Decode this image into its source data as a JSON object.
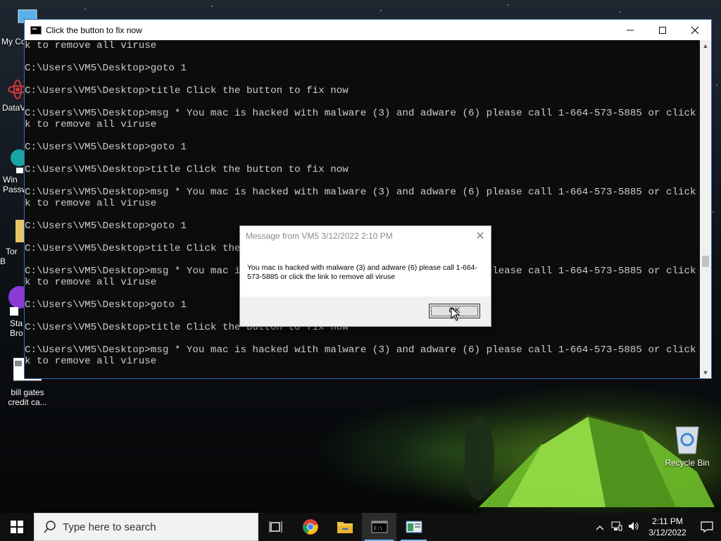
{
  "desktop": {
    "icons": [
      {
        "label": "My Co"
      },
      {
        "label": "DataV"
      },
      {
        "label": "Win Passw"
      },
      {
        "label": "Tor B"
      },
      {
        "label": "Sta Bro"
      },
      {
        "label": "bill gates credit ca..."
      },
      {
        "label": "Recycle Bin"
      }
    ]
  },
  "console": {
    "title": "Click the button to fix now",
    "lines": [
      "k to remove all viruse",
      "",
      "C:\\Users\\VM5\\Desktop>goto 1",
      "",
      "C:\\Users\\VM5\\Desktop>title Click the button to fix now",
      "",
      "C:\\Users\\VM5\\Desktop>msg * You mac is hacked with malware (3) and adware (6) please call 1-664-573-5885 or click the lin",
      "k to remove all viruse",
      "",
      "C:\\Users\\VM5\\Desktop>goto 1",
      "",
      "C:\\Users\\VM5\\Desktop>title Click the button to fix now",
      "",
      "C:\\Users\\VM5\\Desktop>msg * You mac is hacked with malware (3) and adware (6) please call 1-664-573-5885 or click the lin",
      "k to remove all viruse",
      "",
      "C:\\Users\\VM5\\Desktop>goto 1",
      "",
      "C:\\Users\\VM5\\Desktop>title Click the button to fix now",
      "",
      "C:\\Users\\VM5\\Desktop>msg * You mac is hacked with malware (3) and adware (6) please call 1-664-573-5885 or click the lin",
      "k to remove all viruse",
      "",
      "C:\\Users\\VM5\\Desktop>goto 1",
      "",
      "C:\\Users\\VM5\\Desktop>title Click the button to fix now",
      "",
      "C:\\Users\\VM5\\Desktop>msg * You mac is hacked with malware (3) and adware (6) please call 1-664-573-5885 or click the lin",
      "k to remove all viruse"
    ]
  },
  "message_box": {
    "title": "Message from VM5 3/12/2022 2:10 PM",
    "body": "You mac is hacked with malware (3) and adware (6) please call 1-664-573-5885 or click the link to remove all viruse",
    "ok_label": "OK"
  },
  "taskbar": {
    "search_placeholder": "Type here to search",
    "time": "2:11 PM",
    "date": "3/12/2022",
    "apps": [
      "task-view-icon",
      "chrome-icon",
      "file-explorer-icon",
      "command-prompt-icon",
      "app-window-icon"
    ]
  },
  "colors": {
    "console_bg": "#0c0c0c",
    "console_text": "#cccccc",
    "taskbar_bg": "#101010",
    "accent": "#76b9ed"
  }
}
